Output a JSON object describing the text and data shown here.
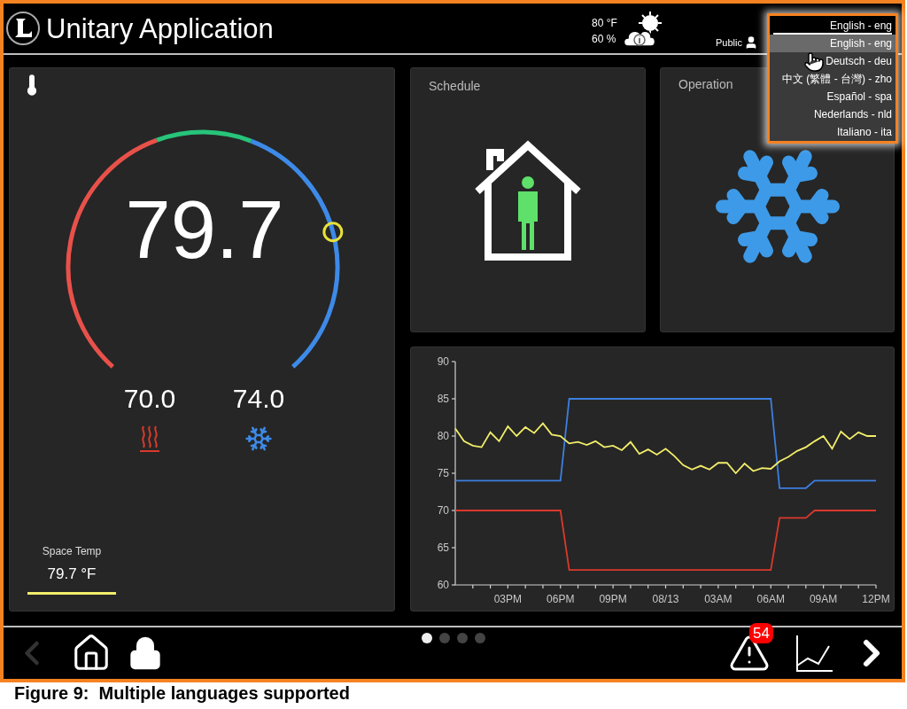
{
  "header": {
    "title": "Unitary Application",
    "weather": {
      "temperature": "80 °F",
      "humidity": "60 %"
    },
    "user": "Public"
  },
  "language_menu": {
    "value": "English - eng",
    "options": [
      {
        "label": "English - eng",
        "selected": true
      },
      {
        "label": "Deutsch - deu",
        "selected": false
      },
      {
        "label": "中文 (繁體 - 台灣) - zho",
        "selected": false
      },
      {
        "label": "Español - spa",
        "selected": false
      },
      {
        "label": "Nederlands - nld",
        "selected": false
      },
      {
        "label": "Italiano - ita",
        "selected": false
      }
    ]
  },
  "thermostat": {
    "reading": "79.7",
    "heat_setpoint": "70.0",
    "cool_setpoint": "74.0",
    "space_temp": {
      "label": "Space Temp",
      "value": "79.7 °F"
    }
  },
  "schedule": {
    "title": "Schedule"
  },
  "operation": {
    "title": "Operation"
  },
  "trend": {
    "chart_data": {
      "type": "line",
      "categories": [
        null,
        null,
        null,
        null,
        null,
        null,
        "03PM",
        null,
        null,
        null,
        null,
        null,
        "06PM",
        null,
        null,
        null,
        null,
        null,
        "09PM",
        null,
        null,
        null,
        null,
        null,
        "08/13",
        null,
        null,
        null,
        null,
        null,
        "03AM",
        null,
        null,
        null,
        null,
        null,
        "06AM",
        null,
        null,
        null,
        null,
        null,
        "09AM",
        null,
        null,
        null,
        null,
        null,
        "12PM"
      ],
      "series": [
        {
          "color": "#3d7fe0",
          "values": [
            74,
            74,
            74,
            74,
            74,
            74,
            74,
            74,
            74,
            74,
            74,
            74,
            74,
            85,
            85,
            85,
            85,
            85,
            85,
            85,
            85,
            85,
            85,
            85,
            85,
            85,
            85,
            85,
            85,
            85,
            85,
            85,
            85,
            85,
            85,
            85,
            85,
            73,
            73,
            73,
            73,
            74,
            74,
            74,
            74,
            74,
            74,
            74,
            74
          ]
        },
        {
          "color": "#d9392c",
          "values": [
            70,
            70,
            70,
            70,
            70,
            70,
            70,
            70,
            70,
            70,
            70,
            70,
            70,
            62,
            62,
            62,
            62,
            62,
            62,
            62,
            62,
            62,
            62,
            62,
            62,
            62,
            62,
            62,
            62,
            62,
            62,
            62,
            62,
            62,
            62,
            62,
            62,
            69,
            69,
            69,
            69,
            70,
            70,
            70,
            70,
            70,
            70,
            70,
            70
          ]
        },
        {
          "color": "#f2ee6a",
          "values": [
            81,
            79.3,
            78.7,
            78.5,
            80.5,
            79.3,
            81.3,
            80,
            81.2,
            80.4,
            81.7,
            80.2,
            80,
            79,
            79.2,
            78.8,
            79.3,
            78.5,
            78.7,
            78.1,
            79.2,
            77.6,
            78.2,
            77.5,
            78.3,
            77.3,
            76.1,
            75.5,
            76,
            75.5,
            76.4,
            76.4,
            75,
            76.3,
            75.3,
            75.7,
            75.6,
            76.6,
            77.2,
            78,
            78.5,
            79.3,
            80,
            78.3,
            80.6,
            79.6,
            80.5,
            80,
            80
          ]
        }
      ],
      "ylim": [
        60,
        90
      ],
      "yticks": [
        60,
        65,
        70,
        75,
        80,
        85,
        90
      ]
    }
  },
  "bottom_bar": {
    "pages": [
      {
        "selected": true
      },
      {
        "selected": false
      },
      {
        "selected": false
      },
      {
        "selected": false
      }
    ],
    "alarm_count": "54"
  },
  "caption": "Figure 9:  Multiple languages supported"
}
